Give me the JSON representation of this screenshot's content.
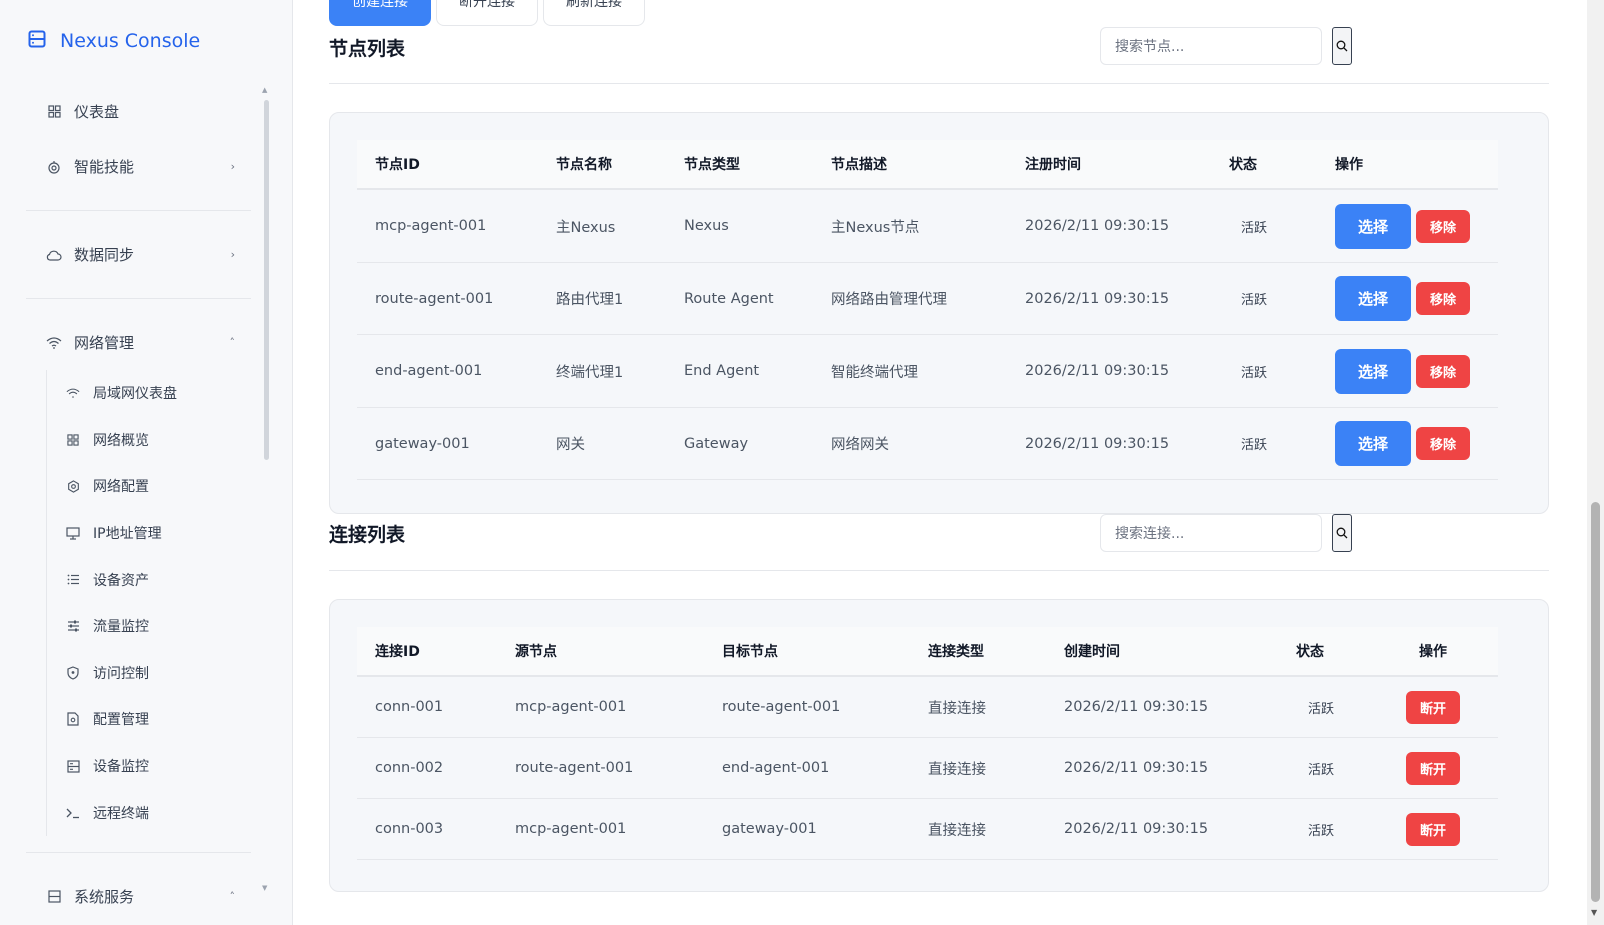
{
  "brand": {
    "title": "Nexus Console"
  },
  "sidebar": {
    "items": [
      {
        "label": "仪表盘",
        "icon": "dashboard-icon"
      },
      {
        "label": "智能技能",
        "icon": "skill-icon",
        "chevron": "›"
      },
      {
        "label": "数据同步",
        "icon": "cloud-icon",
        "chevron": "›"
      },
      {
        "label": "网络管理",
        "icon": "wifi-icon",
        "chevron": "˄"
      }
    ],
    "network_sub": [
      {
        "label": "局域网仪表盘",
        "icon": "wifi-icon"
      },
      {
        "label": "网络概览",
        "icon": "grid-icon"
      },
      {
        "label": "网络配置",
        "icon": "settings-icon"
      },
      {
        "label": "IP地址管理",
        "icon": "monitor-icon"
      },
      {
        "label": "设备资产",
        "icon": "list-icon"
      },
      {
        "label": "流量监控",
        "icon": "sliders-icon"
      },
      {
        "label": "访问控制",
        "icon": "shield-icon"
      },
      {
        "label": "配置管理",
        "icon": "file-icon"
      },
      {
        "label": "设备监控",
        "icon": "server-icon"
      },
      {
        "label": "远程终端",
        "icon": "terminal-icon"
      }
    ],
    "system": {
      "label": "系统服务",
      "icon": "server-icon",
      "chevron": "˄"
    }
  },
  "toolbar": {
    "create_label": "创建连接",
    "disconnect_label": "断开连接",
    "refresh_label": "刷新连接"
  },
  "nodes": {
    "title": "节点列表",
    "search_placeholder": "搜索节点...",
    "headers": [
      "节点ID",
      "节点名称",
      "节点类型",
      "节点描述",
      "注册时间",
      "状态",
      "操作"
    ],
    "rows": [
      {
        "id": "mcp-agent-001",
        "name": "主Nexus",
        "type": "Nexus",
        "desc": "主Nexus节点",
        "time": "2026/2/11 09:30:15",
        "status": "活跃"
      },
      {
        "id": "route-agent-001",
        "name": "路由代理1",
        "type": "Route Agent",
        "desc": "网络路由管理代理",
        "time": "2026/2/11 09:30:15",
        "status": "活跃"
      },
      {
        "id": "end-agent-001",
        "name": "终端代理1",
        "type": "End Agent",
        "desc": "智能终端代理",
        "time": "2026/2/11 09:30:15",
        "status": "活跃"
      },
      {
        "id": "gateway-001",
        "name": "网关",
        "type": "Gateway",
        "desc": "网络网关",
        "time": "2026/2/11 09:30:15",
        "status": "活跃"
      }
    ],
    "select_label": "选择",
    "remove_label": "移除"
  },
  "connections": {
    "title": "连接列表",
    "search_placeholder": "搜索连接...",
    "headers": [
      "连接ID",
      "源节点",
      "目标节点",
      "连接类型",
      "创建时间",
      "状态",
      "操作"
    ],
    "rows": [
      {
        "id": "conn-001",
        "src": "mcp-agent-001",
        "dst": "route-agent-001",
        "type": "直接连接",
        "time": "2026/2/11 09:30:15",
        "status": "活跃"
      },
      {
        "id": "conn-002",
        "src": "route-agent-001",
        "dst": "end-agent-001",
        "type": "直接连接",
        "time": "2026/2/11 09:30:15",
        "status": "活跃"
      },
      {
        "id": "conn-003",
        "src": "mcp-agent-001",
        "dst": "gateway-001",
        "type": "直接连接",
        "time": "2026/2/11 09:30:15",
        "status": "活跃"
      }
    ],
    "disconnect_label": "断开"
  },
  "colors": {
    "primary": "#3b82f6",
    "danger": "#ef4444",
    "brand": "#2563eb"
  }
}
